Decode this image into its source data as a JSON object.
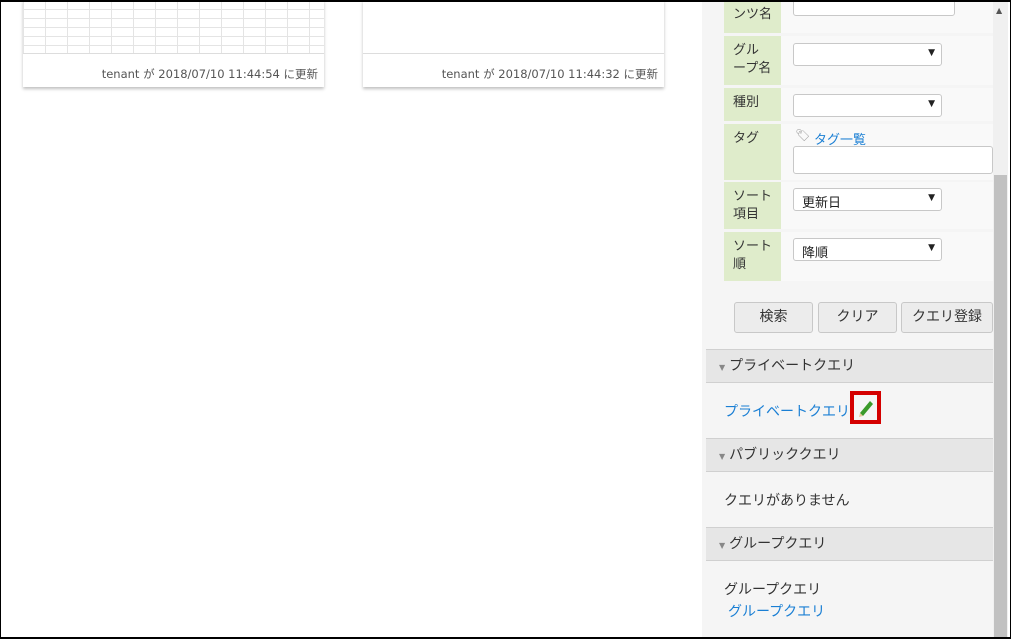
{
  "cards": [
    {
      "meta": "tenant が 2018/07/10 11:44:54 に更新",
      "has_grid": true
    },
    {
      "meta": "tenant が 2018/07/10 11:44:32 に更新",
      "has_grid": false
    }
  ],
  "search_form": {
    "content_name_label": "コンテンツ名",
    "group_name_label": "グループ名",
    "group_name_value": "",
    "type_label": "種別",
    "type_value": "",
    "tag_label": "タグ",
    "tag_list_link": "タグ一覧",
    "sort_field_label": "ソート項目",
    "sort_field_value": "更新日",
    "sort_order_label": "ソート順",
    "sort_order_value": "降順"
  },
  "buttons": {
    "search": "検索",
    "clear": "クリア",
    "register_query": "クエリ登録"
  },
  "private_queries": {
    "header": "プライベートクエリ",
    "items": [
      "プライベートクエリ"
    ]
  },
  "public_queries": {
    "header": "パブリッククエリ",
    "empty": "クエリがありません"
  },
  "group_queries": {
    "header": "グループクエリ",
    "group_name": "グループクエリ",
    "items": [
      "グループクエリ"
    ]
  },
  "colors": {
    "label_bg": "#dfeccb",
    "link": "#1a7fd4",
    "highlight": "#d40000",
    "pencil": "#3a9a2a"
  }
}
